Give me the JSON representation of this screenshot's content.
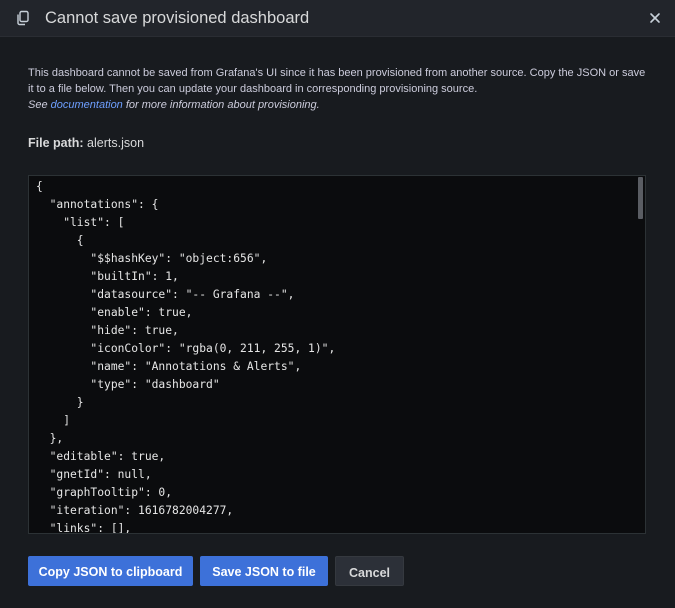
{
  "modal": {
    "title": "Cannot save provisioned dashboard",
    "description": "This dashboard cannot be saved from Grafana's UI since it has been provisioned from another source. Copy the JSON or save it to a file below. Then you can update your dashboard in corresponding provisioning source.",
    "hint_prefix": "See",
    "hint_link": "documentation",
    "hint_suffix": "for more information about provisioning.",
    "file_path_label": "File path:",
    "file_path_value": "alerts.json"
  },
  "editor": {
    "code": "{\n  \"annotations\": {\n    \"list\": [\n      {\n        \"$$hashKey\": \"object:656\",\n        \"builtIn\": 1,\n        \"datasource\": \"-- Grafana --\",\n        \"enable\": true,\n        \"hide\": true,\n        \"iconColor\": \"rgba(0, 211, 255, 1)\",\n        \"name\": \"Annotations & Alerts\",\n        \"type\": \"dashboard\"\n      }\n    ]\n  },\n  \"editable\": true,\n  \"gnetId\": null,\n  \"graphTooltip\": 0,\n  \"iteration\": 1616782004277,\n  \"links\": [],"
  },
  "buttons": {
    "copy_label": "Copy JSON to clipboard",
    "save_label": "Save JSON to file",
    "cancel_label": "Cancel"
  },
  "icons": {
    "header": "copy-icon",
    "close": "close-icon"
  },
  "colors": {
    "background": "#181b1f",
    "header_background": "#22252b",
    "editor_background": "#0b0c0e",
    "primary": "#3d71d9",
    "link": "#6e9fff",
    "text": "#ccccdc"
  }
}
